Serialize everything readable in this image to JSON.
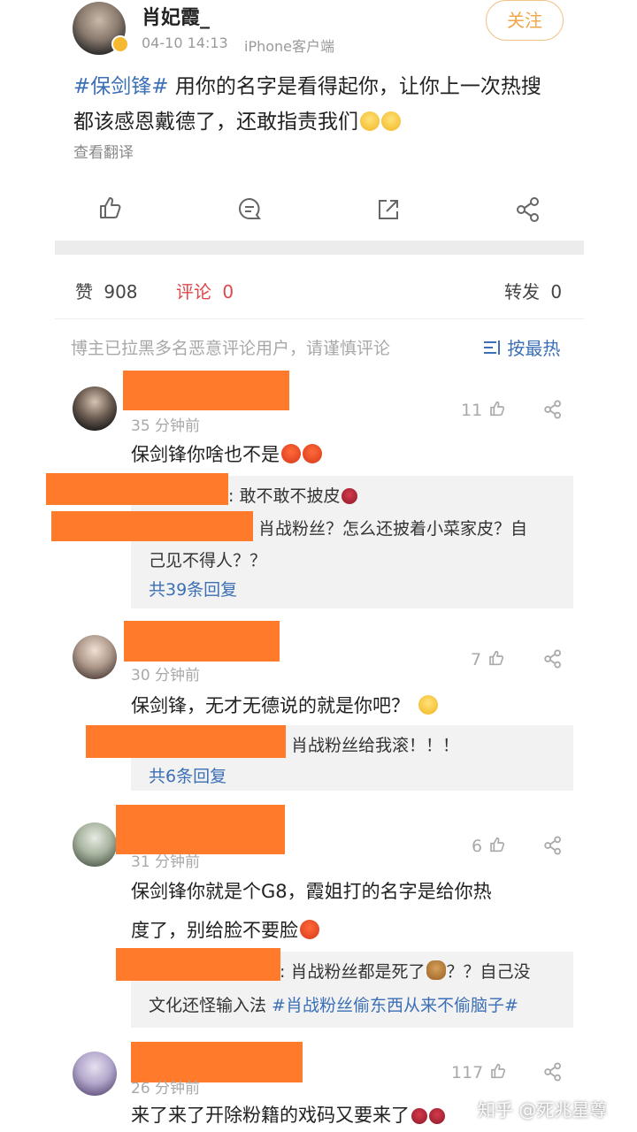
{
  "post": {
    "author": "肖妃霞_",
    "time": "04-10 14:13",
    "source": "iPhone客户端",
    "follow_label": "关注",
    "topic": "#保剑锋#",
    "body_line1_rest": " 用你的名字是看得起你，让你上一次热搜",
    "body_line2": "都该感恩戴德了，还敢指责我们",
    "translate_label": "查看翻译"
  },
  "stats": {
    "like_label": "赞",
    "like_count": "908",
    "comment_label": "评论",
    "comment_count": "0",
    "repost_label": "转发",
    "repost_count": "0"
  },
  "notice": {
    "text": "博主已拉黑多名恶意评论用户，请谨慎评论",
    "sort_label": "按最热"
  },
  "comments": [
    {
      "time": "35 分钟前",
      "likes": "11",
      "text": "保剑锋你啥也不是",
      "replies": [
        {
          "text": ": 敢不敢不披皮"
        },
        {
          "text_line1": "肖战粉丝？怎么还披着小菜家皮？自",
          "text_line2": "己见不得人？？"
        }
      ],
      "more": "共39条回复"
    },
    {
      "time": "30 分钟前",
      "likes": "7",
      "text": "保剑锋，无才无德说的就是你吧？",
      "replies": [
        {
          "text": "肖战粉丝给我滚！！！"
        }
      ],
      "more": "共6条回复"
    },
    {
      "time": "31 分钟前",
      "likes": "6",
      "text_line1": "保剑锋你就是个G8，霞姐打的名字是给你热",
      "text_line2": "度了，别给脸不要脸",
      "replies": [
        {
          "text_line1": ": 肖战粉丝都是死了",
          "text_line1_rest": "？？自己没",
          "text_line2_plain": "文化还怪输入法 ",
          "topic": "#肖战粉丝偷东西从来不偷脑子#"
        }
      ]
    },
    {
      "time": "26 分钟前",
      "likes": "117",
      "text": "来了来了开除粉籍的戏码又要来了"
    }
  ],
  "watermark": "知乎 @死兆星尊",
  "colors": {
    "accent_orange": "#ff7a2a",
    "link_blue": "#3b6fb6",
    "comment_red": "#e0474c",
    "follow_orange": "#f0a64a"
  }
}
